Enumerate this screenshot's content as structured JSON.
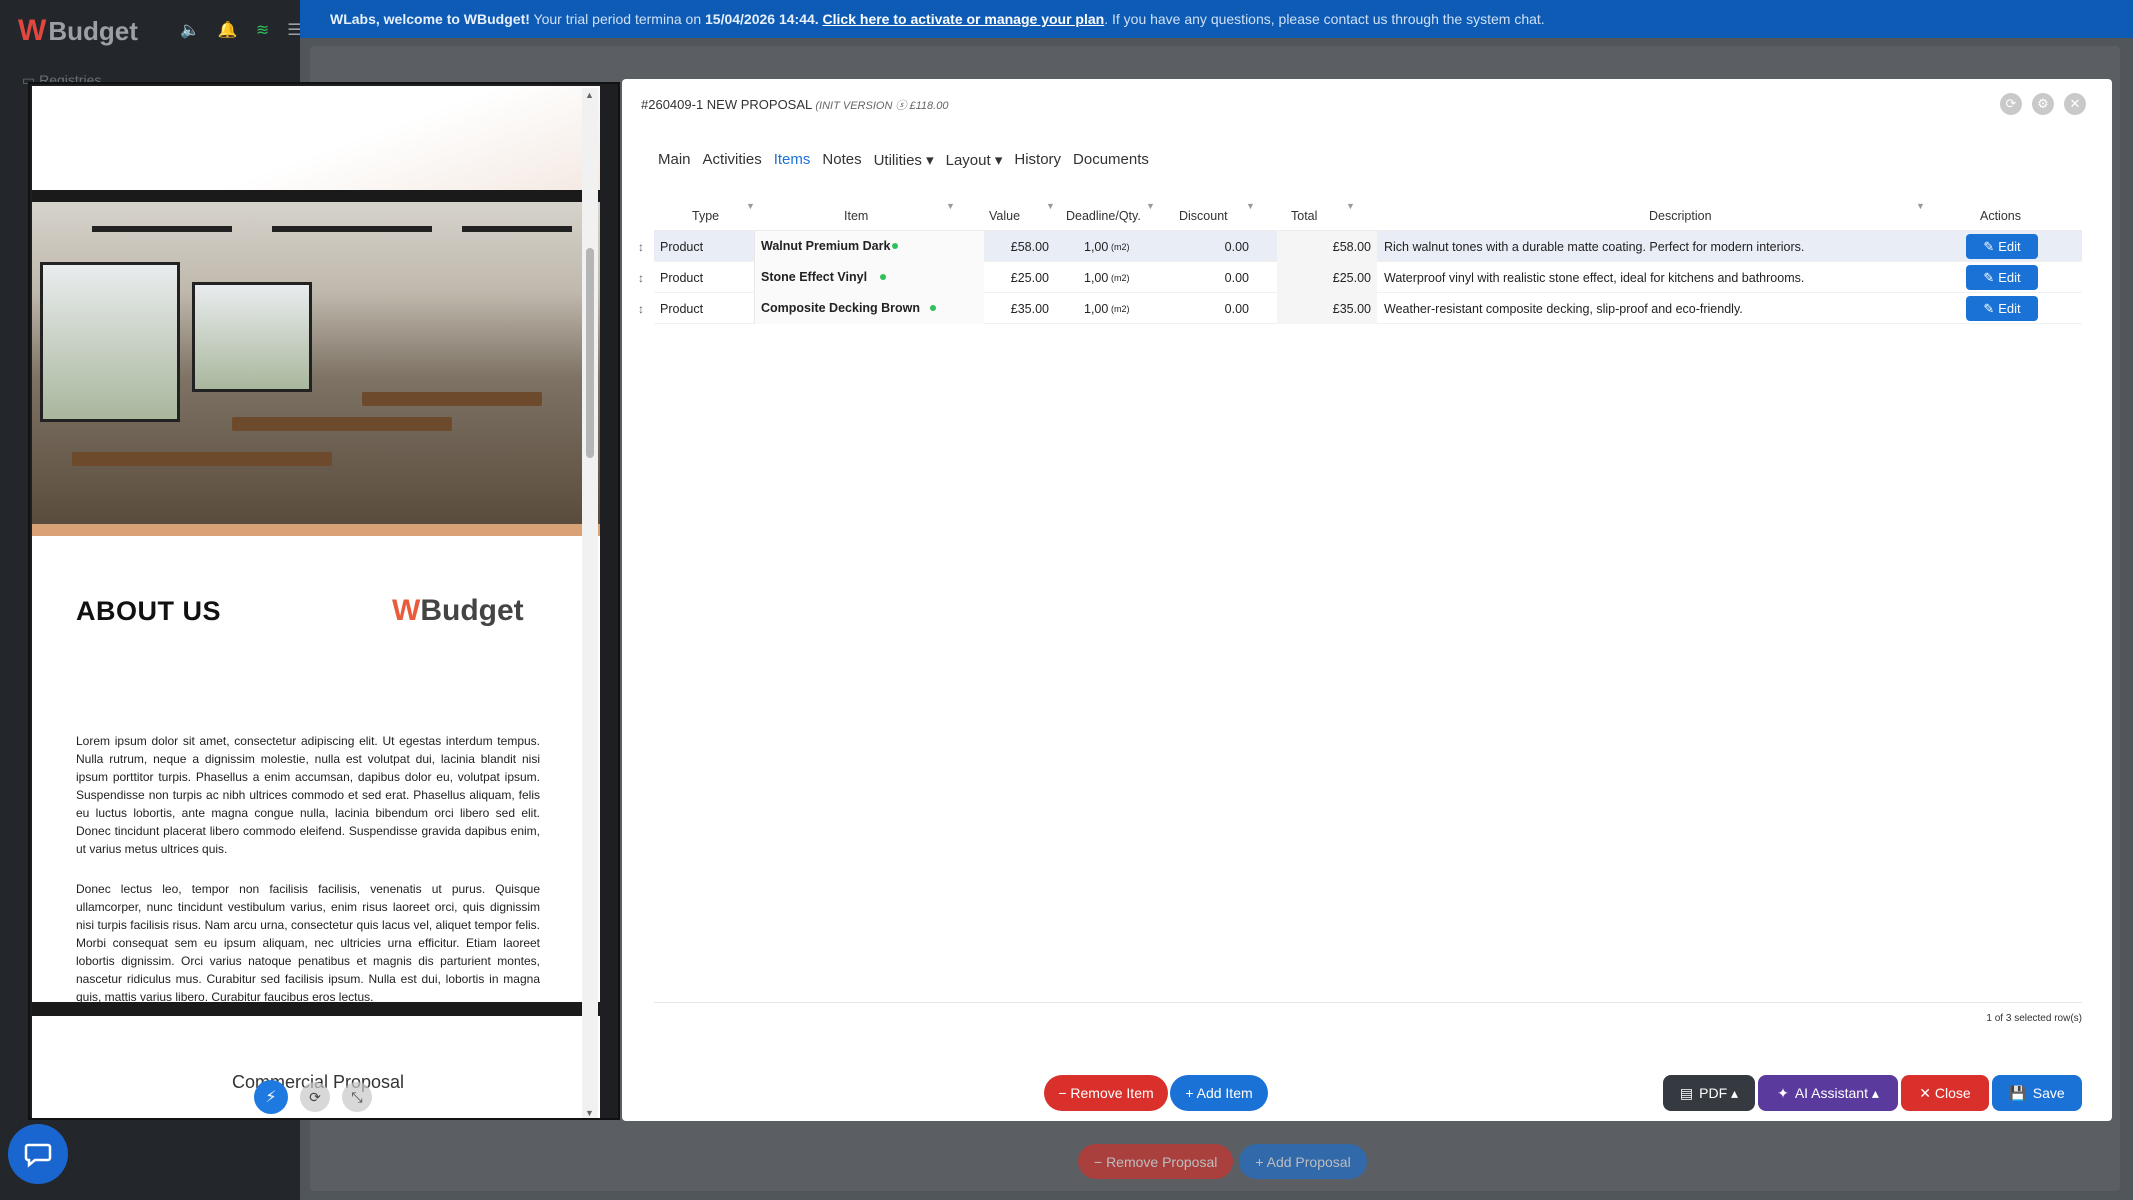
{
  "app": {
    "logo_mark": "W",
    "logo_word": "Budget",
    "side_item": "Registries"
  },
  "banner": {
    "bold": "WLabs, welcome to WBudget!",
    "text1": " Your trial period termina on ",
    "date": "15/04/2026 14:44.",
    "link": "Click here to activate or manage your plan",
    "text2": ". If you have any questions, please contact us through the system chat."
  },
  "background_buttons": {
    "remove": "− Remove Proposal",
    "add": "+ Add Proposal"
  },
  "preview": {
    "about_title": "ABOUT US",
    "about_logo_w": "W",
    "about_logo_word": "Budget",
    "paragraph1": "Lorem ipsum dolor sit amet, consectetur adipiscing elit. Ut egestas interdum tempus. Nulla rutrum, neque a dignissim molestie, nulla est volutpat dui, lacinia blandit nisi ipsum porttitor turpis. Phasellus a enim accumsan, dapibus dolor eu, volutpat ipsum. Suspendisse non turpis ac nibh ultrices commodo et sed erat. Phasellus aliquam, felis eu luctus lobortis, ante magna congue nulla, lacinia bibendum orci libero sed elit. Donec tincidunt placerat libero commodo eleifend. Suspendisse gravida dapibus enim, ut varius metus ultrices quis.",
    "paragraph2": "Donec lectus leo, tempor non facilisis facilisis, venenatis ut purus. Quisque ullamcorper, nunc tincidunt vestibulum varius, enim risus laoreet orci, quis dignissim nisi turpis facilisis risus. Nam arcu urna, consectetur quis lacus vel, aliquet tempor felis. Morbi consequat sem eu ipsum aliquam, nec ultricies urna efficitur. Etiam laoreet lobortis dignissim. Orci varius natoque penatibus et magnis dis parturient montes, nascetur ridiculus mus. Curabitur sed facilisis ipsum. Nulla est dui, lobortis in magna quis, mattis varius libero. Curabitur faucibus eros lectus.",
    "page3_text": "Commercial Proposal"
  },
  "modal": {
    "title": "#260409-1  NEW PROPOSAL ",
    "version": "(INIT VERSION ⓢ £118.00",
    "tabs": [
      {
        "label": "Main"
      },
      {
        "label": "Activities"
      },
      {
        "label": "Items",
        "active": true
      },
      {
        "label": "Notes"
      },
      {
        "label": "Utilities ▾"
      },
      {
        "label": "Layout ▾"
      },
      {
        "label": "History"
      },
      {
        "label": "Documents"
      }
    ],
    "columns": {
      "type": "Type",
      "item": "Item",
      "value": "Value",
      "deadline": "Deadline/Qty.",
      "discount": "Discount",
      "total": "Total",
      "description": "Description",
      "actions": "Actions"
    },
    "rows": [
      {
        "type": "Product",
        "item": "Walnut Premium Dark",
        "value": "£58.00",
        "qty": "1,00",
        "unit": "(m2)",
        "discount": "0.00",
        "total": "£58.00",
        "description": "Rich walnut tones with a durable matte coating. Perfect for modern interiors.",
        "edit": "Edit"
      },
      {
        "type": "Product",
        "item": "Stone Effect Vinyl",
        "value": "£25.00",
        "qty": "1,00",
        "unit": "(m2)",
        "discount": "0.00",
        "total": "£25.00",
        "description": "Waterproof vinyl with realistic stone effect, ideal for kitchens and bathrooms.",
        "edit": "Edit"
      },
      {
        "type": "Product",
        "item": "Composite Decking Brown",
        "value": "£35.00",
        "qty": "1,00",
        "unit": "(m2)",
        "discount": "0.00",
        "total": "£35.00",
        "description": "Weather-resistant composite decking, slip-proof and eco-friendly.",
        "edit": "Edit"
      }
    ],
    "selected_count": "1 of 3 selected row(s)",
    "footer": {
      "remove_item": "− Remove Item",
      "add_item": "+ Add Item",
      "pdf": "PDF ▴",
      "ai": "AI Assistant ▴",
      "close": "✕ Close",
      "save": "Save"
    }
  },
  "colors": {
    "primary": "#1b72d6",
    "danger": "#d9302c",
    "banner": "#0d5bb5",
    "purple": "#5b3a9e",
    "status_dot": "#2ec15a"
  }
}
